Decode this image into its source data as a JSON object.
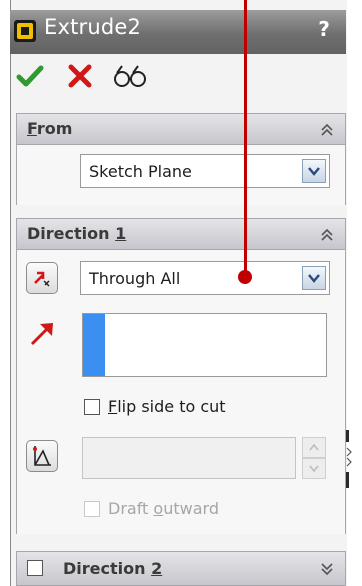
{
  "title": "Extrude2",
  "help": "?",
  "toolbar": {
    "ok_icon": "check-icon",
    "cancel_icon": "x-icon",
    "preview_icon": "glasses-icon"
  },
  "from": {
    "header_prefix": "",
    "header_underlined": "F",
    "header_rest": "rom",
    "select_value": "Sketch Plane"
  },
  "direction1": {
    "header_main": "Direction ",
    "header_underlined": "1",
    "end_condition": "Through All",
    "flip_label_underlined": "F",
    "flip_label_rest": "lip side to cut",
    "flip_checked": false,
    "draft_prefix": "Draft ",
    "draft_underlined": "o",
    "draft_rest": "utward",
    "draft_enabled": false
  },
  "direction2": {
    "header_main": "Direction ",
    "header_underlined": "2",
    "checked": false
  },
  "colors": {
    "annotation": "#c00000",
    "accent": "#2e8cf0",
    "titlebar": "#6f6f6f"
  }
}
